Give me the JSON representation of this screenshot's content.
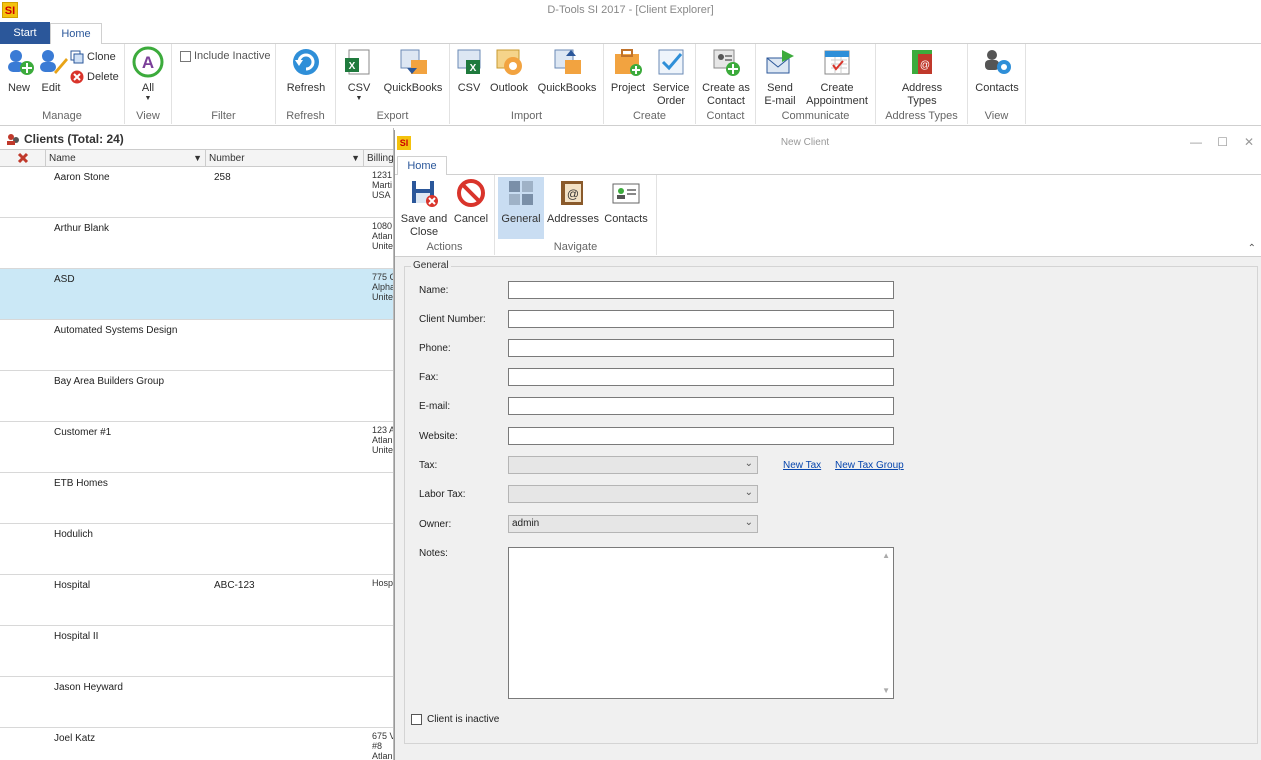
{
  "app": {
    "logo_text": "SI",
    "window_title": "D-Tools SI 2017 - [Client Explorer]"
  },
  "ribbon_tabs": {
    "start": "Start",
    "home": "Home"
  },
  "ribbon": {
    "manage": {
      "label": "Manage",
      "new": "New",
      "edit": "Edit",
      "clone": "Clone",
      "delete": "Delete"
    },
    "view1": {
      "label": "View",
      "all": "All"
    },
    "filter": {
      "label": "Filter",
      "include_inactive": "Include Inactive"
    },
    "refresh": {
      "label": "Refresh",
      "refresh": "Refresh"
    },
    "export": {
      "label": "Export",
      "csv": "CSV",
      "quickbooks": "QuickBooks"
    },
    "import": {
      "label": "Import",
      "csv": "CSV",
      "outlook": "Outlook",
      "quickbooks": "QuickBooks"
    },
    "create": {
      "label": "Create",
      "project": "Project",
      "service_order_1": "Service",
      "service_order_2": "Order"
    },
    "contact": {
      "label": "Contact",
      "create_as_1": "Create as",
      "create_as_2": "Contact"
    },
    "communicate": {
      "label": "Communicate",
      "send_1": "Send",
      "send_2": "E-mail",
      "appt_1": "Create",
      "appt_2": "Appointment"
    },
    "address_types": {
      "label": "Address Types",
      "btn_1": "Address",
      "btn_2": "Types"
    },
    "view2": {
      "label": "View",
      "contacts": "Contacts"
    }
  },
  "clients": {
    "header": "Clients (Total: 24)",
    "columns": {
      "name": "Name",
      "number": "Number",
      "billing": "Billing"
    },
    "rows": [
      {
        "name": "Aaron Stone",
        "number": "258",
        "billing": "1231\nMarti\nUSA"
      },
      {
        "name": "Arthur Blank",
        "number": "",
        "billing": "1080\nAtlan\nUnite"
      },
      {
        "name": "ASD",
        "number": "",
        "billing": "775 C\nAlpha\nUnite"
      },
      {
        "name": "Automated Systems Design",
        "number": "",
        "billing": ""
      },
      {
        "name": "Bay Area Builders Group",
        "number": "",
        "billing": ""
      },
      {
        "name": "Customer #1",
        "number": "",
        "billing": "123 A\nAtlan\nUnite"
      },
      {
        "name": "ETB Homes",
        "number": "",
        "billing": ""
      },
      {
        "name": "Hodulich",
        "number": "",
        "billing": ""
      },
      {
        "name": "Hospital",
        "number": "ABC-123",
        "billing": "Hosp"
      },
      {
        "name": "Hospital II",
        "number": "",
        "billing": ""
      },
      {
        "name": "Jason Heyward",
        "number": "",
        "billing": ""
      },
      {
        "name": "Joel Katz",
        "number": "",
        "billing": "675 V\n#8\nAtlan"
      }
    ]
  },
  "dialog": {
    "logo_text": "SI",
    "title": "New Client",
    "tab_home": "Home",
    "actions": {
      "label": "Actions",
      "save_1": "Save and",
      "save_2": "Close",
      "cancel": "Cancel"
    },
    "navigate": {
      "label": "Navigate",
      "general": "General",
      "addresses": "Addresses",
      "contacts": "Contacts"
    },
    "form": {
      "legend": "General",
      "name_label": "Name:",
      "name_value": "",
      "client_number_label": "Client Number:",
      "client_number_value": "",
      "phone_label": "Phone:",
      "phone_value": "",
      "fax_label": "Fax:",
      "fax_value": "",
      "email_label": "E-mail:",
      "email_value": "",
      "website_label": "Website:",
      "website_value": "",
      "tax_label": "Tax:",
      "tax_value": "",
      "new_tax": "New Tax",
      "new_tax_group": "New Tax Group",
      "labor_tax_label": "Labor Tax:",
      "labor_tax_value": "",
      "owner_label": "Owner:",
      "owner_value": "admin",
      "notes_label": "Notes:",
      "inactive_label": "Client is inactive"
    }
  }
}
